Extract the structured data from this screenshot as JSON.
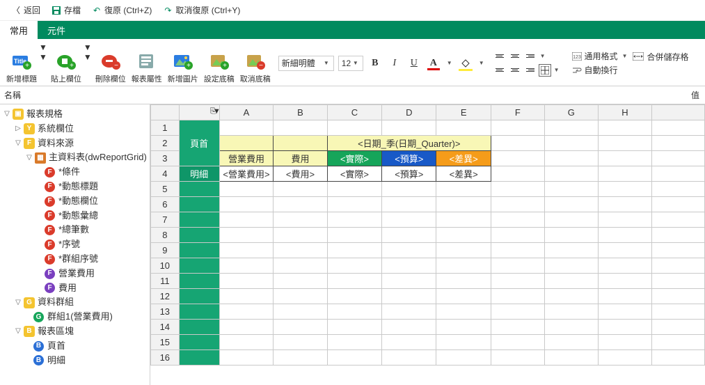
{
  "topbar": {
    "back": "返回",
    "save": "存檔",
    "undo": "復原 (Ctrl+Z)",
    "redo": "取消復原 (Ctrl+Y)"
  },
  "tabs": {
    "common": "常用",
    "component": "元件"
  },
  "ribbon": {
    "addTitle": "新增標題",
    "pasteField": "貼上欄位",
    "deleteField": "刪除欄位",
    "reportProp": "報表屬性",
    "addImage": "新增圖片",
    "setTemplate": "設定底稿",
    "cancelTemplate": "取消底稿",
    "fontName": "新細明體",
    "fontSize": "12",
    "numFormat": "通用格式",
    "merge": "合併儲存格",
    "wrap": "自動換行"
  },
  "namebar": {
    "name": "名稱",
    "value": "值"
  },
  "tree": {
    "root": "報表規格",
    "sysCols": "系統欄位",
    "dataSource": "資料來源",
    "mainTable": "主資料表(dwReportGrid)",
    "items": {
      "cond": "*條件",
      "dynTitle": "*動態標題",
      "dynCol": "*動態欄位",
      "dynSum": "*動態彙總",
      "totalCount": "*總筆數",
      "seq": "*序號",
      "groupSeq": "*群組序號",
      "opExpense": "營業費用",
      "expense": "費用"
    },
    "dataGroup": "資料群組",
    "group1": "群組1(營業費用)",
    "blocks": "報表區塊",
    "header": "頁首",
    "detail": "明細"
  },
  "sheet": {
    "cols": [
      "A",
      "B",
      "C",
      "D",
      "E",
      "F",
      "G",
      "H"
    ],
    "rows": [
      "1",
      "2",
      "3",
      "4",
      "5",
      "6",
      "7",
      "8",
      "9",
      "10",
      "11",
      "12",
      "13",
      "14",
      "15",
      "16"
    ],
    "sectionHeader": "頁首",
    "sectionDetail": "明細",
    "r2": {
      "dateQuarter": "<日期_季(日期_Quarter)>"
    },
    "r3": {
      "a": "營業費用",
      "b": "費用",
      "c": "<實際>",
      "d": "<預算>",
      "e": "<差異>"
    },
    "r4": {
      "a": "<營業費用>",
      "b": "<費用>",
      "c": "<實際>",
      "d": "<預算>",
      "e": "<差異>"
    }
  }
}
